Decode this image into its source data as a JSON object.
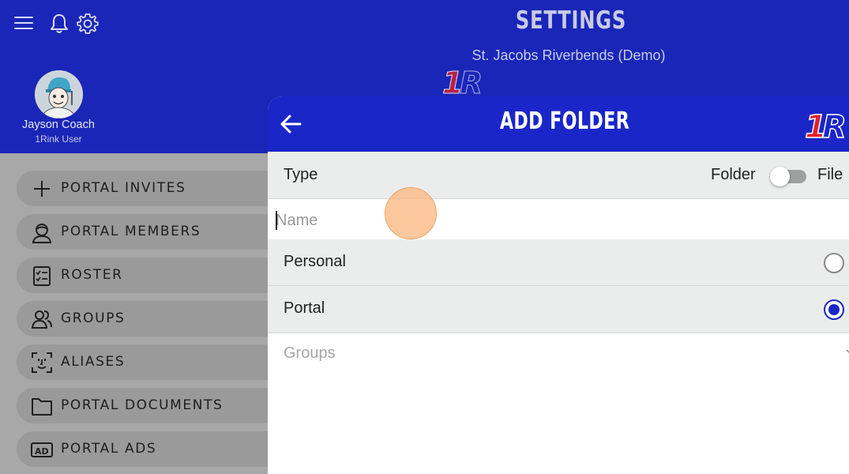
{
  "header": {
    "title": "SETTINGS",
    "subtitle": "St. Jacobs Riverbends (Demo)",
    "icons": {
      "menu": "hamburger-icon",
      "notifications": "bell-icon",
      "settings": "gear-icon"
    },
    "logo": "1R"
  },
  "user": {
    "name": "Jayson Coach",
    "role": "1Rink User"
  },
  "sidebar": {
    "items": [
      {
        "label": "PORTAL INVITES",
        "icon": "plus-icon"
      },
      {
        "label": "PORTAL MEMBERS",
        "icon": "member-icon"
      },
      {
        "label": "ROSTER",
        "icon": "checklist-icon"
      },
      {
        "label": "GROUPS",
        "icon": "people-icon"
      },
      {
        "label": "ALIASES",
        "icon": "face-scan-icon"
      },
      {
        "label": "PORTAL DOCUMENTS",
        "icon": "folder-icon"
      },
      {
        "label": "PORTAL ADS",
        "icon": "ad-icon"
      }
    ]
  },
  "modal": {
    "title": "ADD FOLDER",
    "logo": "1R",
    "type_label": "Type",
    "toggle": {
      "left_label": "Folder",
      "right_label": "File",
      "state": "Folder"
    },
    "name_placeholder": "Name",
    "name_value": "",
    "options": [
      {
        "label": "Personal",
        "selected": false
      },
      {
        "label": "Portal",
        "selected": true
      }
    ],
    "groups_placeholder": "Groups"
  },
  "colors": {
    "header_blue": "#1a26b8",
    "modal_blue": "#1a26c8",
    "logo_red": "#e0202a",
    "dim_overlay": "#a8a8a8",
    "row_gray": "#ebeded"
  }
}
